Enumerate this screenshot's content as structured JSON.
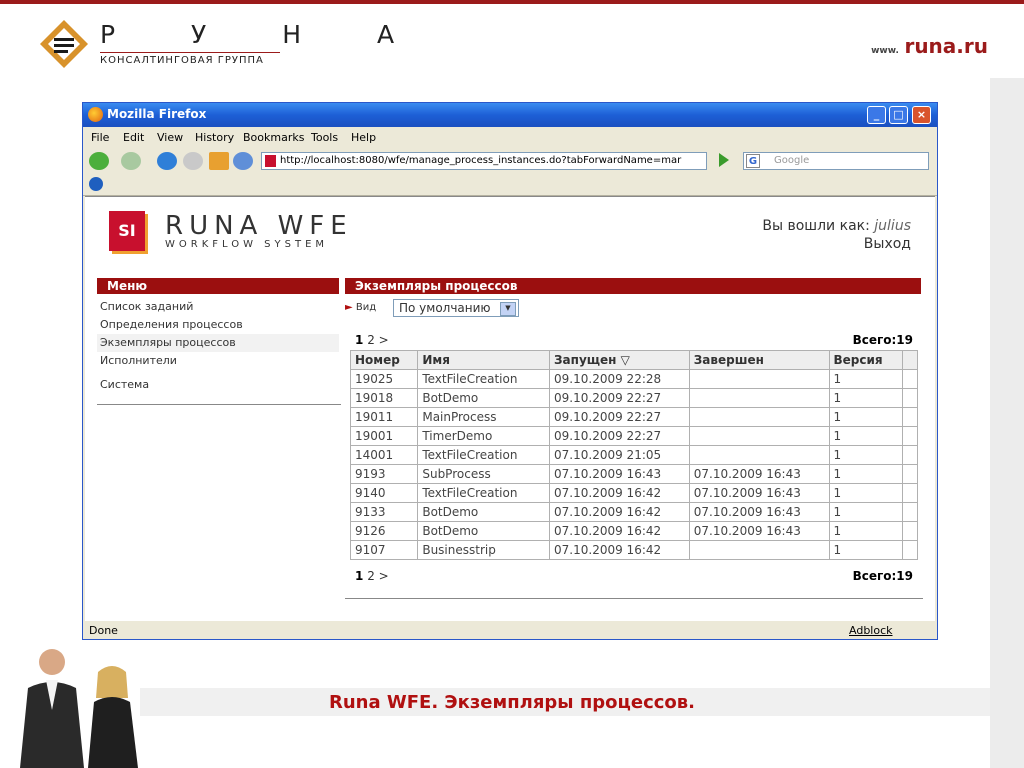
{
  "slide": {
    "logo_letters": "Р У Н А",
    "logo_subtitle": "КОНСАЛТИНГОВАЯ ГРУППА",
    "site_prefix": "www.",
    "site_domain": "runa.ru",
    "caption": "Runa WFE. Экземпляры процессов."
  },
  "browser": {
    "title": "Mozilla Firefox",
    "menu": [
      "File",
      "Edit",
      "View",
      "History",
      "Bookmarks",
      "Tools",
      "Help"
    ],
    "url": "http://localhost:8080/wfe/manage_process_instances.do?tabForwardName=mar",
    "search_placeholder": "Google",
    "status_left": "Done",
    "status_right": "Adblock"
  },
  "app": {
    "logo_text": "RUNA WFE",
    "logo_sub": "WORKFLOW SYSTEM",
    "logo_badge": "SI",
    "login_label": "Вы вошли как:",
    "login_user": "julius",
    "logout": "Выход",
    "menu_title": "Меню",
    "menu_items": [
      "Список заданий",
      "Определения процессов",
      "Экземпляры процессов",
      "Исполнители",
      "Система"
    ],
    "main_title": "Экземпляры процессов",
    "view_label": "Вид",
    "view_value": "По умолчанию",
    "pager_current": "1",
    "pager_other": "2",
    "pager_next": ">",
    "total": "Всего:19",
    "columns": [
      "Номер",
      "Имя",
      "Запущен ▽",
      "Завершен",
      "Версия"
    ],
    "rows": [
      [
        "19025",
        "TextFileCreation",
        "09.10.2009 22:28",
        "",
        "1"
      ],
      [
        "19018",
        "BotDemo",
        "09.10.2009 22:27",
        "",
        "1"
      ],
      [
        "19011",
        "MainProcess",
        "09.10.2009 22:27",
        "",
        "1"
      ],
      [
        "19001",
        "TimerDemo",
        "09.10.2009 22:27",
        "",
        "1"
      ],
      [
        "14001",
        "TextFileCreation",
        "07.10.2009 21:05",
        "",
        "1"
      ],
      [
        "9193",
        "SubProcess",
        "07.10.2009 16:43",
        "07.10.2009 16:43",
        "1"
      ],
      [
        "9140",
        "TextFileCreation",
        "07.10.2009 16:42",
        "07.10.2009 16:43",
        "1"
      ],
      [
        "9133",
        "BotDemo",
        "07.10.2009 16:42",
        "07.10.2009 16:43",
        "1"
      ],
      [
        "9126",
        "BotDemo",
        "07.10.2009 16:42",
        "07.10.2009 16:43",
        "1"
      ],
      [
        "9107",
        "Businesstrip",
        "07.10.2009 16:42",
        "",
        "1"
      ]
    ]
  },
  "colors": {
    "accent": "#9b0f0f",
    "caption": "#b01010"
  }
}
